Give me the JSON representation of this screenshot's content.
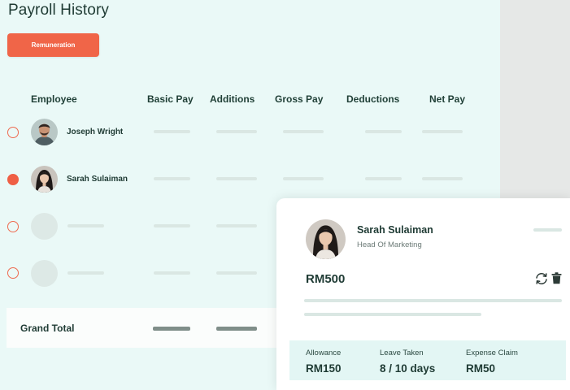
{
  "page": {
    "title": "Payroll History"
  },
  "toolbar": {
    "remuneration_label": "Remuneration"
  },
  "table": {
    "columns": [
      "Employee",
      "Basic Pay",
      "Additions",
      "Gross Pay",
      "Deductions",
      "Net Pay"
    ],
    "rows": [
      {
        "name": "Joseph Wright",
        "selected": false
      },
      {
        "name": "Sarah Sulaiman",
        "selected": true
      },
      {
        "name": "",
        "selected": false
      },
      {
        "name": "",
        "selected": false
      }
    ],
    "grand_total_label": "Grand Total"
  },
  "detail_card": {
    "name": "Sarah Sulaiman",
    "role": "Head Of Marketing",
    "amount": "RM500",
    "stats": [
      {
        "label": "Allowance",
        "value": "RM150"
      },
      {
        "label": "Leave Taken",
        "value": "8 / 10 days"
      },
      {
        "label": "Expense Claim",
        "value": "RM50"
      }
    ]
  },
  "colors": {
    "accent": "#f06548",
    "background": "#eaf9f7",
    "text": "#1f3b34"
  },
  "icons": [
    "refresh-icon",
    "trash-icon"
  ]
}
